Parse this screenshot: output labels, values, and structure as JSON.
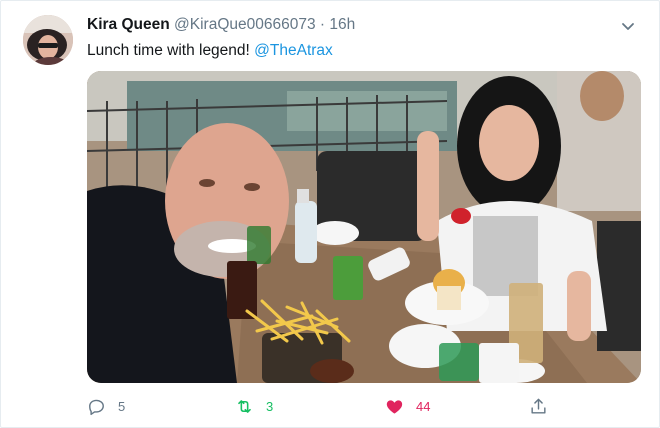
{
  "tweet": {
    "author_name": "Kira Queen",
    "author_handle": "@KiraQue00666073",
    "separator": "·",
    "time": "16h",
    "text_main": "Lunch time with legend! ",
    "text_mention": "@TheAtrax"
  },
  "actions": {
    "reply_count": "5",
    "retweet_count": "3",
    "like_count": "44"
  },
  "icons": {
    "caret": "chevron-down-icon",
    "reply": "reply-icon",
    "retweet": "retweet-icon",
    "like": "heart-icon",
    "share": "share-icon"
  },
  "colors": {
    "mention": "#1b95e0",
    "retweet": "#17bf63",
    "like": "#e0245e",
    "muted": "#657786"
  }
}
